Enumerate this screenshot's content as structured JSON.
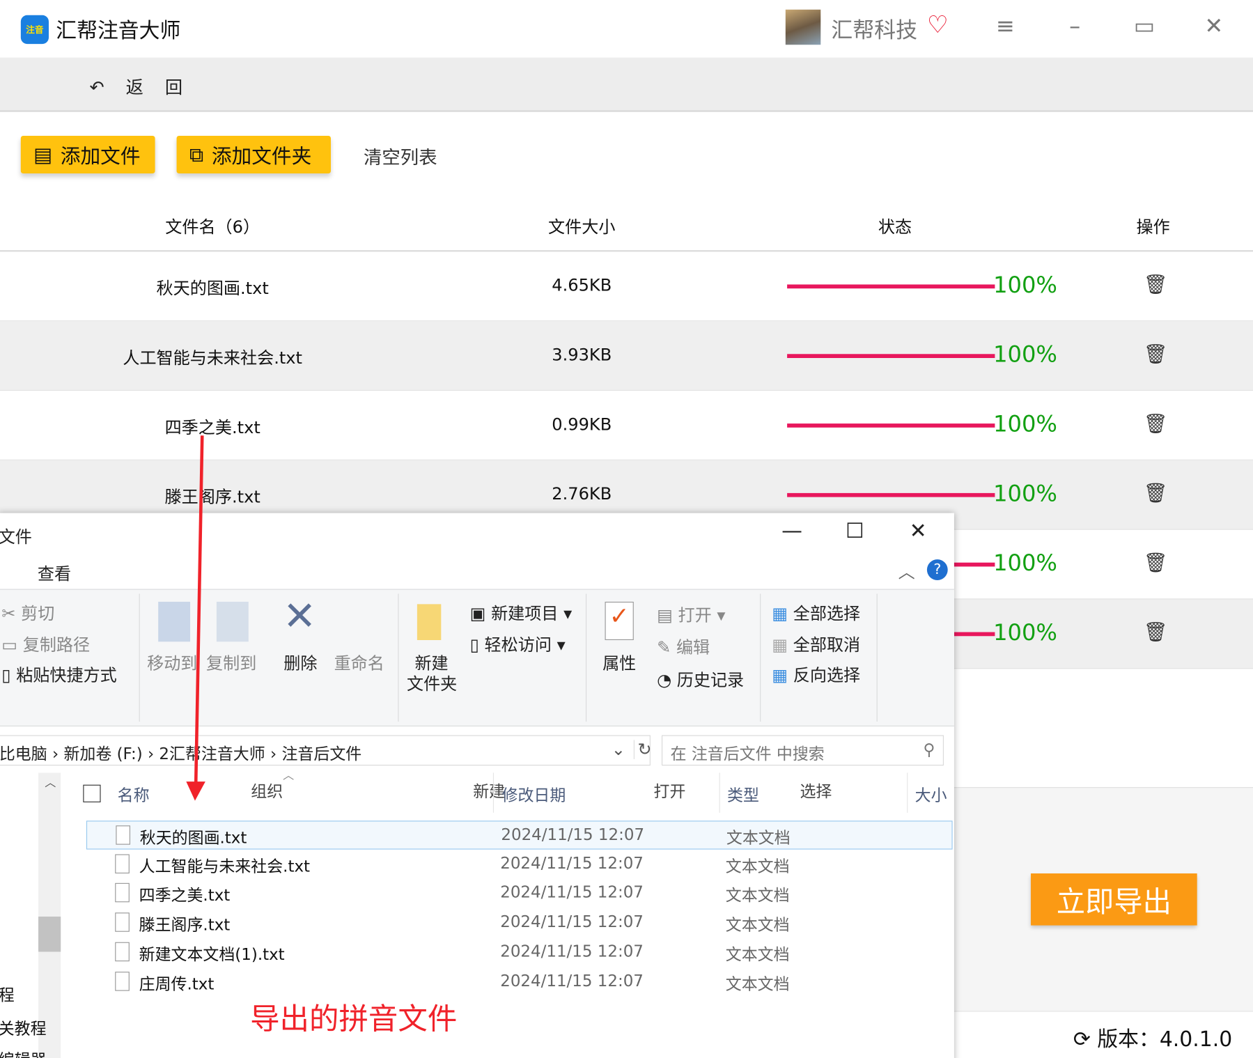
{
  "app": {
    "title": "汇帮注音大师",
    "logo_text": "注音",
    "brand": "汇帮科技",
    "back_label": "返 回"
  },
  "toolbar": {
    "add_file": "添加文件",
    "add_folder": "添加文件夹",
    "clear_list": "清空列表"
  },
  "table": {
    "headers": [
      "文件名（6）",
      "文件大小",
      "状态",
      "操作"
    ],
    "rows": [
      {
        "name": "秋天的图画.txt",
        "size": "4.65KB",
        "progress": 100,
        "status": "100%"
      },
      {
        "name": "人工智能与未来社会.txt",
        "size": "3.93KB",
        "progress": 100,
        "status": "100%"
      },
      {
        "name": "四季之美.txt",
        "size": "0.99KB",
        "progress": 100,
        "status": "100%"
      },
      {
        "name": "滕王阁序.txt",
        "size": "2.76KB",
        "progress": 100,
        "status": "100%"
      },
      {
        "name": "",
        "size": "",
        "progress": 100,
        "status": "100%"
      },
      {
        "name": "",
        "size": "",
        "progress": 100,
        "status": "100%"
      }
    ]
  },
  "export_label": "立即导出",
  "version": "版本：4.0.1.0",
  "colors": {
    "accent": "#ffc20e",
    "export": "#fb9a14",
    "progress": "#e8175d",
    "pct": "#12a012",
    "annotation": "#f0222a"
  },
  "explorer": {
    "title": "文件",
    "tab": "查看",
    "ribbon": {
      "clipboard": [
        "剪切",
        "复制路径",
        "粘贴快捷方式"
      ],
      "organize": {
        "move": "移动到",
        "copy": "复制到",
        "delete": "删除",
        "rename": "重命名",
        "label": "组织"
      },
      "new": {
        "new_folder_1": "新建",
        "new_folder_2": "文件夹",
        "new_item": "新建项目",
        "easy_access": "轻松访问",
        "label": "新建"
      },
      "open": {
        "properties": "属性",
        "open": "打开",
        "edit": "编辑",
        "history": "历史记录",
        "label": "打开"
      },
      "select": {
        "all": "全部选择",
        "none": "全部取消",
        "invert": "反向选择",
        "label": "选择"
      }
    },
    "breadcrumb": [
      "比电脑",
      "新加卷 (F:)",
      "2汇帮注音大师",
      "注音后文件"
    ],
    "search_placeholder": "在 注音后文件 中搜索",
    "columns": [
      "名称",
      "修改日期",
      "类型",
      "大小"
    ],
    "files": [
      {
        "name": "秋天的图画.txt",
        "date": "2024/11/15 12:07",
        "type": "文本文档"
      },
      {
        "name": "人工智能与未来社会.txt",
        "date": "2024/11/15 12:07",
        "type": "文本文档"
      },
      {
        "name": "四季之美.txt",
        "date": "2024/11/15 12:07",
        "type": "文本文档"
      },
      {
        "name": "滕王阁序.txt",
        "date": "2024/11/15 12:07",
        "type": "文本文档"
      },
      {
        "name": "新建文本文档(1).txt",
        "date": "2024/11/15 12:07",
        "type": "文本文档"
      },
      {
        "name": "庄周传.txt",
        "date": "2024/11/15 12:07",
        "type": "文本文档"
      }
    ],
    "nav": [
      "程",
      "关教程",
      "编辑器"
    ]
  },
  "annotation": "导出的拼音文件"
}
